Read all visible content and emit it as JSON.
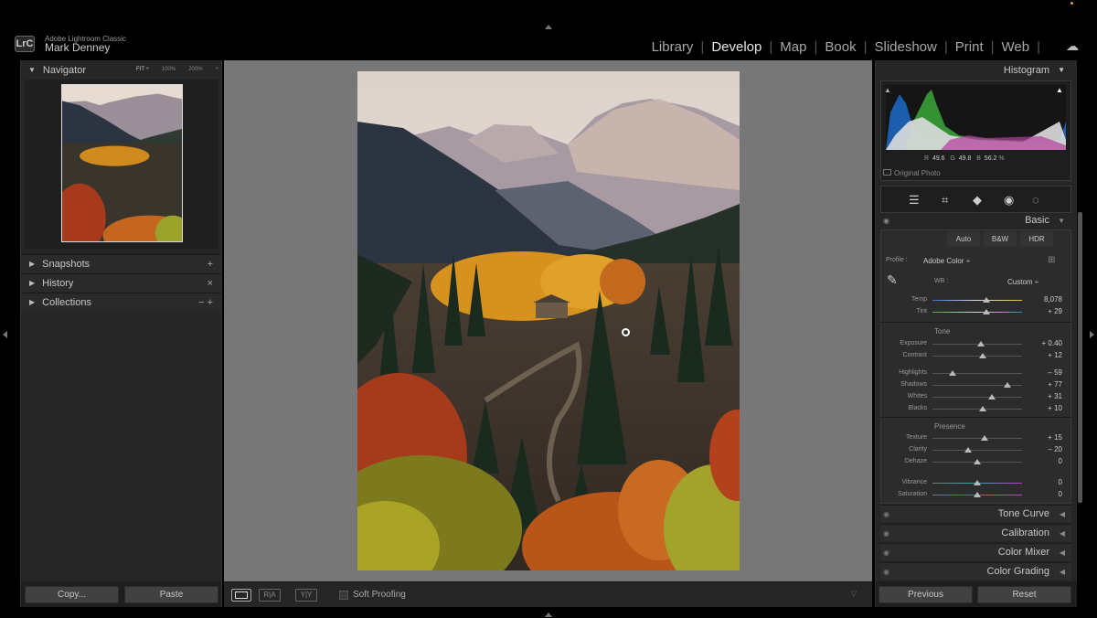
{
  "app": {
    "logo": "LrC",
    "name": "Adobe Lightroom Classic",
    "user": "Mark Denney"
  },
  "modules": [
    {
      "label": "Library",
      "active": false
    },
    {
      "label": "Develop",
      "active": true
    },
    {
      "label": "Map",
      "active": false
    },
    {
      "label": "Book",
      "active": false
    },
    {
      "label": "Slideshow",
      "active": false
    },
    {
      "label": "Print",
      "active": false
    },
    {
      "label": "Web",
      "active": false
    }
  ],
  "left": {
    "navigator": {
      "title": "Navigator",
      "zoom": [
        "FIT ÷",
        "100%",
        "200%",
        "÷"
      ]
    },
    "snapshots": {
      "title": "Snapshots",
      "action": "+"
    },
    "history": {
      "title": "History",
      "action": "×"
    },
    "collections": {
      "title": "Collections",
      "action": "−  +"
    },
    "copy_label": "Copy...",
    "paste_label": "Paste"
  },
  "toolbar": {
    "soft_proofing": "Soft Proofing",
    "ra": "R|A",
    "yy": "Y|Y"
  },
  "right": {
    "histogram": {
      "title": "Histogram",
      "r_label": "R",
      "r": "49.6",
      "g_label": "G",
      "g": "49.8",
      "b_label": "B",
      "b": "56.2",
      "unit": "%",
      "original_photo": "Original Photo"
    },
    "basic": {
      "title": "Basic",
      "auto": "Auto",
      "bw": "B&W",
      "hdr": "HDR",
      "profile_label": "Profile :",
      "profile_value": "Adobe Color ÷",
      "wb_label": "WB :",
      "wb_value": "Custom ÷",
      "tone_label": "Tone",
      "presence_label": "Presence",
      "sliders": [
        {
          "label": "Temp",
          "value": "8,078",
          "pos": 0.6
        },
        {
          "label": "Tint",
          "value": "+ 29",
          "pos": 0.6
        },
        {
          "label": "Exposure",
          "value": "+ 0.40",
          "pos": 0.54
        },
        {
          "label": "Contrast",
          "value": "+ 12",
          "pos": 0.56
        },
        {
          "label": "Highlights",
          "value": "– 59",
          "pos": 0.22
        },
        {
          "label": "Shadows",
          "value": "+ 77",
          "pos": 0.84
        },
        {
          "label": "Whites",
          "value": "+ 31",
          "pos": 0.66
        },
        {
          "label": "Blacks",
          "value": "+ 10",
          "pos": 0.56
        },
        {
          "label": "Texture",
          "value": "+ 15",
          "pos": 0.58
        },
        {
          "label": "Clarity",
          "value": "– 20",
          "pos": 0.4
        },
        {
          "label": "Dehaze",
          "value": "0",
          "pos": 0.5
        },
        {
          "label": "Vibrance",
          "value": "0",
          "pos": 0.5
        },
        {
          "label": "Saturation",
          "value": "0",
          "pos": 0.5
        }
      ]
    },
    "panels": [
      "Tone Curve",
      "Calibration",
      "Color Mixer",
      "Color Grading"
    ],
    "previous_label": "Previous",
    "reset_label": "Reset"
  },
  "icons": [
    "lrc-logo",
    "cloud-icon",
    "eye-icon",
    "sliders-icon",
    "crop-icon",
    "eraser-icon",
    "redeye-icon",
    "mask-icon",
    "eyedropper-icon",
    "grid-icon"
  ]
}
